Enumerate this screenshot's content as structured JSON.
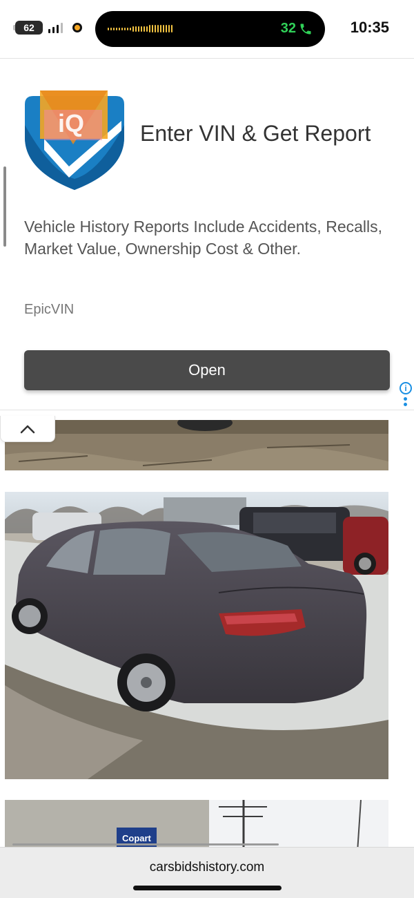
{
  "status_bar": {
    "battery": "62",
    "call_timer": "32",
    "time": "10:35"
  },
  "ad": {
    "logo_text": "iQ",
    "title": "Enter VIN & Get Report",
    "description": "Vehicle History Reports Include Accidents, Recalls, Market Value, Ownership Cost & Other.",
    "advertiser": "EpicVIN",
    "button_label": "Open",
    "info_icon": "i",
    "icons": [
      "info-icon",
      "more-vertical-icon"
    ]
  },
  "photos": {
    "sign_text": "Copart"
  },
  "browser": {
    "url": "carsbidshistory.com"
  },
  "icons": {
    "collapse": "chevron-up-icon",
    "call": "phone-icon"
  },
  "colors": {
    "call_green": "#30d158",
    "ad_button": "#4a4a4a",
    "ad_info": "#1a8fe3"
  }
}
